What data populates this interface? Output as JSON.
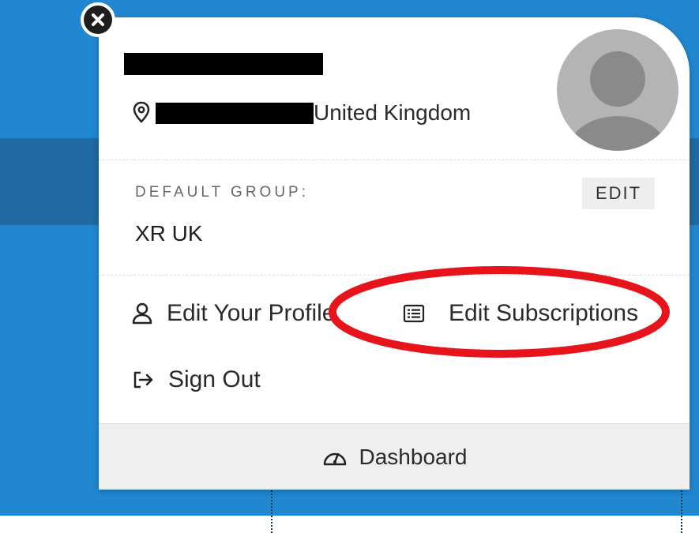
{
  "profile": {
    "location_suffix": "United Kingdom",
    "location_icon": "map-pin-icon",
    "avatar_icon": "user-avatar-icon"
  },
  "group": {
    "label": "DEFAULT GROUP:",
    "edit_label": "EDIT",
    "value": "XR UK"
  },
  "menu": {
    "edit_profile": "Edit Your Profile",
    "edit_subscriptions": "Edit Subscriptions",
    "sign_out": "Sign Out"
  },
  "footer": {
    "dashboard": "Dashboard",
    "dashboard_icon": "gauge-icon"
  },
  "colors": {
    "background_blue": "#2187d1",
    "band_blue": "#1f6aa3",
    "annotation_red": "#e8141c"
  }
}
